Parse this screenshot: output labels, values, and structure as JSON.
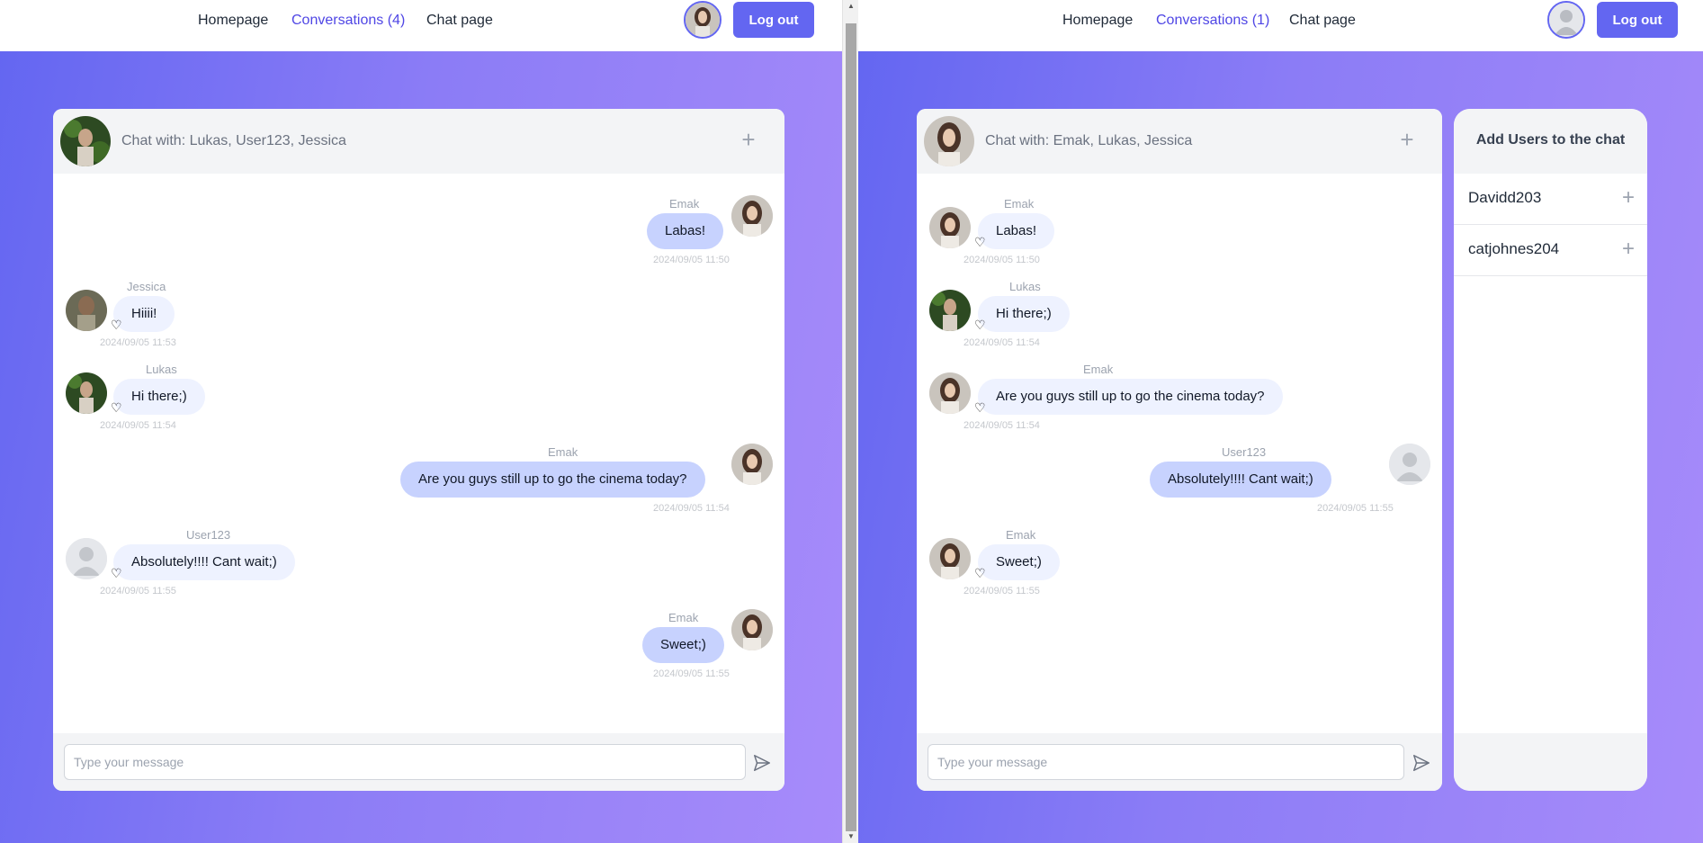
{
  "left": {
    "nav": {
      "home": "Homepage",
      "conversations": "Conversations (4)",
      "chat": "Chat page",
      "logout": "Log out"
    },
    "chat_title": "Chat with: Lukas, User123, Jessica",
    "input_placeholder": "Type your message",
    "messages": [
      {
        "name": "Emak",
        "text": "Labas!",
        "time": "2024/09/05 11:50"
      },
      {
        "name": "Jessica",
        "text": "Hiiii!",
        "time": "2024/09/05 11:53"
      },
      {
        "name": "Lukas",
        "text": "Hi there;)",
        "time": "2024/09/05 11:54"
      },
      {
        "name": "Emak",
        "text": "Are you guys still up to go the cinema today?",
        "time": "2024/09/05 11:54"
      },
      {
        "name": "User123",
        "text": "Absolutely!!!! Cant wait;)",
        "time": "2024/09/05 11:55"
      },
      {
        "name": "Emak",
        "text": "Sweet;)",
        "time": "2024/09/05 11:55"
      }
    ]
  },
  "right": {
    "nav": {
      "home": "Homepage",
      "conversations": "Conversations (1)",
      "chat": "Chat page",
      "logout": "Log out"
    },
    "chat_title": "Chat with: Emak, Lukas, Jessica",
    "input_placeholder": "Type your message",
    "messages": [
      {
        "name": "Emak",
        "text": "Labas!",
        "time": "2024/09/05 11:50"
      },
      {
        "name": "Lukas",
        "text": "Hi there;)",
        "time": "2024/09/05 11:54"
      },
      {
        "name": "Emak",
        "text": "Are you guys still up to go the cinema today?",
        "time": "2024/09/05 11:54"
      },
      {
        "name": "User123",
        "text": "Absolutely!!!! Cant wait;)",
        "time": "2024/09/05 11:55"
      },
      {
        "name": "Emak",
        "text": "Sweet;)",
        "time": "2024/09/05 11:55"
      }
    ],
    "add_users": {
      "title": "Add Users to the chat",
      "users": [
        "Davidd203",
        "catjohnes204"
      ]
    }
  },
  "colors": {
    "accent": "#6366f1",
    "outgoing_bubble": "#c7d2fe",
    "incoming_bubble": "#eef2ff",
    "header_bg": "#f3f4f6"
  },
  "icons": [
    "plus-icon",
    "send-icon",
    "heart-icon",
    "default-avatar-icon"
  ]
}
